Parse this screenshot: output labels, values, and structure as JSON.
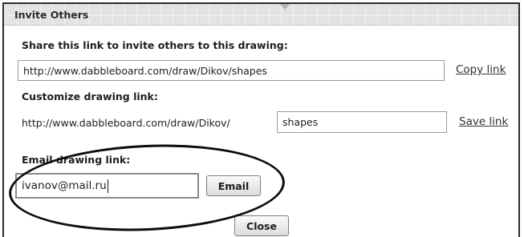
{
  "dialog": {
    "title": "Invite Others",
    "share": {
      "label": "Share this link to invite others to this drawing:",
      "url": "http://www.dabbleboard.com/draw/Dikov/shapes",
      "copy_link": "Copy link"
    },
    "customize": {
      "label": "Customize drawing link:",
      "prefix": "http://www.dabbleboard.com/draw/Dikov/",
      "name_value": "shapes",
      "save_link": "Save link"
    },
    "email": {
      "label": "Email drawing link:",
      "value": "ivanov@mail.ru",
      "button": "Email"
    },
    "close_button": "Close"
  }
}
